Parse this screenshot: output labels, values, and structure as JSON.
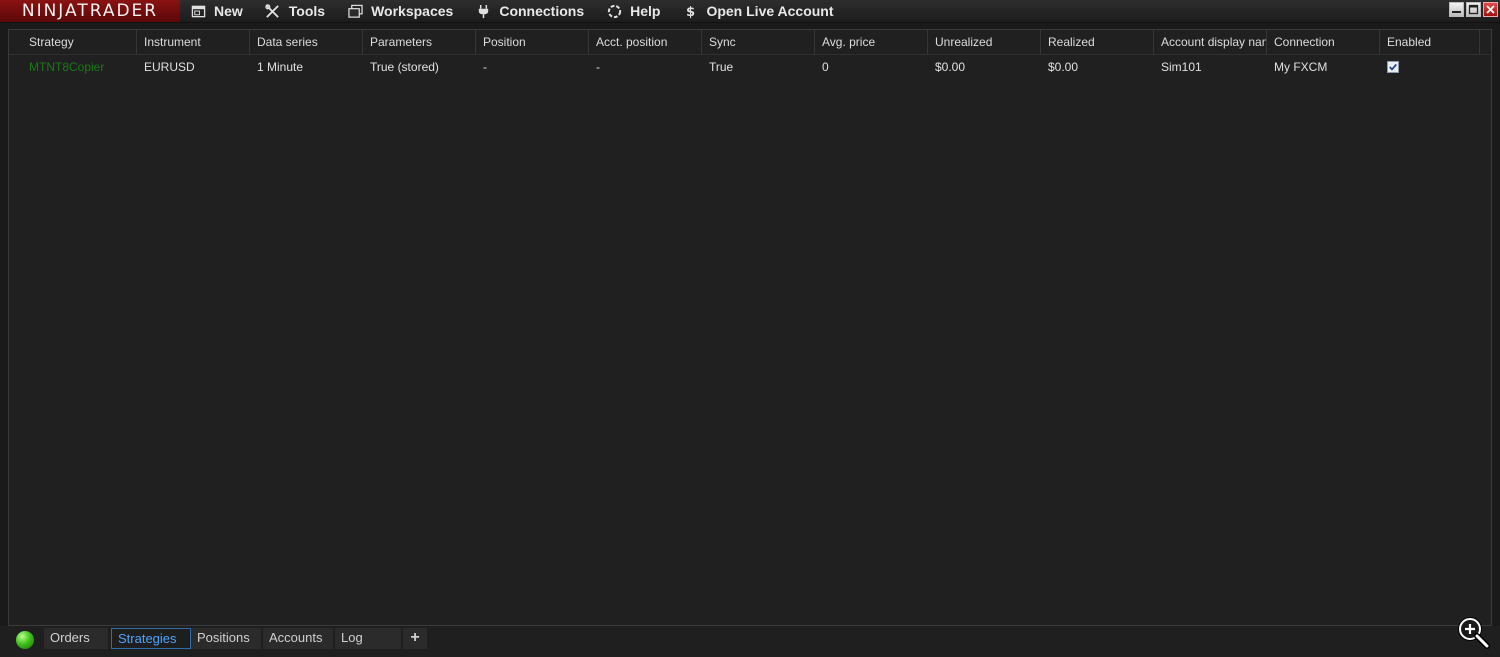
{
  "app": {
    "logo_text": "NINJATRADER"
  },
  "menu": [
    {
      "label": "New",
      "icon": "new-window-icon"
    },
    {
      "label": "Tools",
      "icon": "tools-icon"
    },
    {
      "label": "Workspaces",
      "icon": "workspaces-icon"
    },
    {
      "label": "Connections",
      "icon": "plug-icon"
    },
    {
      "label": "Help",
      "icon": "help-icon"
    },
    {
      "label": "Open Live Account",
      "icon": "dollar-icon"
    }
  ],
  "window_buttons": [
    "minimize-icon",
    "maximize-icon",
    "close-icon"
  ],
  "grid": {
    "columns": [
      "Strategy",
      "Instrument",
      "Data series",
      "Parameters",
      "Position",
      "Acct. position",
      "Sync",
      "Avg. price",
      "Unrealized",
      "Realized",
      "Account display nam",
      "Connection",
      "Enabled"
    ],
    "rows": [
      {
        "strategy": "MTNT8Copier",
        "instrument": "EURUSD",
        "data_series": "1 Minute",
        "parameters": "True (stored)",
        "position": "-",
        "acct_position": "-",
        "sync": "True",
        "avg_price": "0",
        "unrealized": "$0.00",
        "realized": "$0.00",
        "account": "Sim101",
        "connection": "My FXCM",
        "enabled": true
      }
    ]
  },
  "tabs": {
    "status": "connected",
    "items": [
      "Orders",
      "Strategies",
      "Positions",
      "Accounts",
      "Log"
    ],
    "active": "Strategies",
    "add_label": "+"
  },
  "colors": {
    "strategy_text": "#167a16",
    "active_tab_text": "#4aa3ff",
    "logo_bg": "#7a0f0f"
  }
}
